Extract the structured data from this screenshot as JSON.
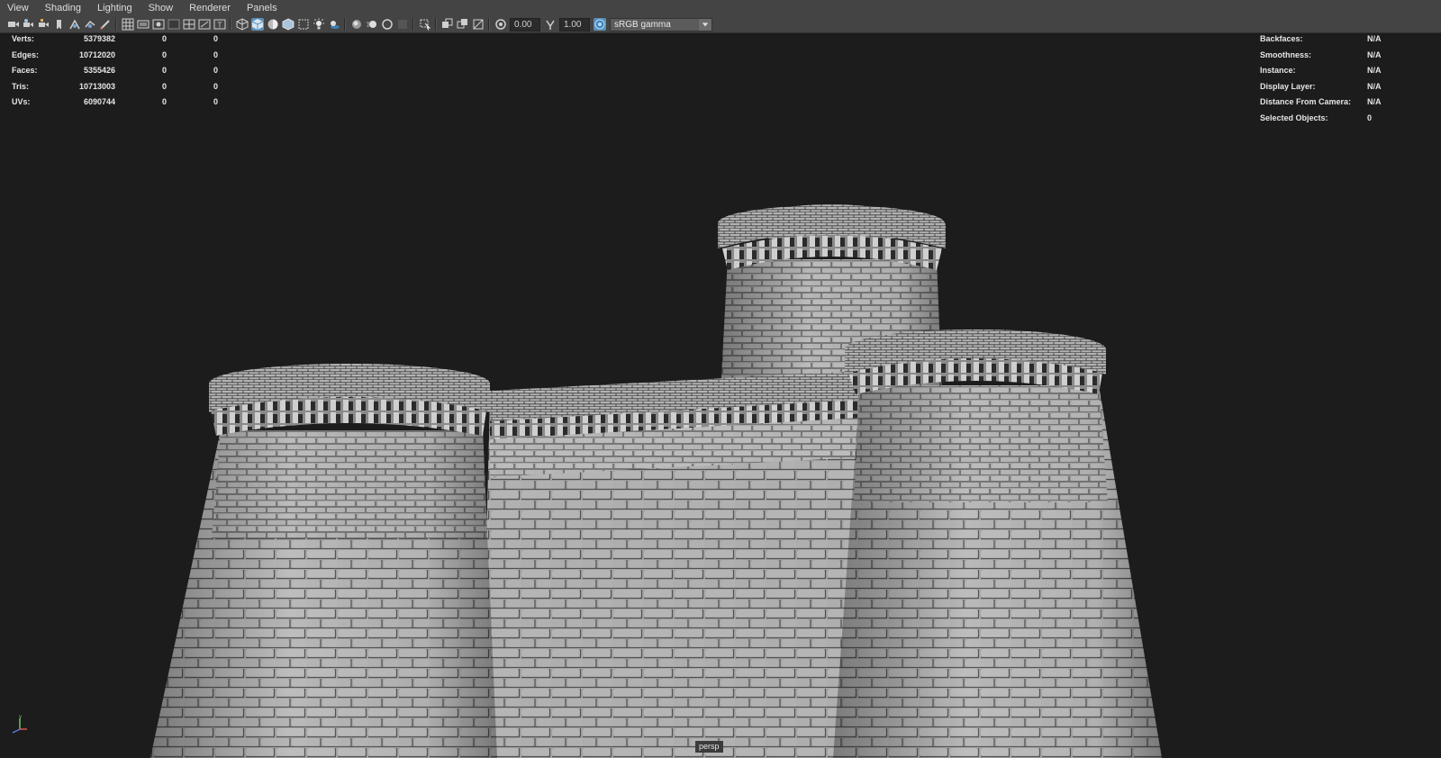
{
  "menu": [
    "View",
    "Shading",
    "Lighting",
    "Show",
    "Renderer",
    "Panels"
  ],
  "toolbar": {
    "exposure": "0.00",
    "gamma": "1.00",
    "color_space": "sRGB gamma",
    "icons": [
      "camera-icon",
      "camera-attributes-icon",
      "bookmark-icon",
      "image-plane-icon",
      "2d-pan-zoom-icon",
      "grease-pencil-icon",
      "grid-icon",
      "film-gate-icon",
      "resolution-gate-icon",
      "gate-mask-icon",
      "field-chart-icon",
      "safe-action-icon",
      "safe-title-icon",
      "wireframe-icon",
      "smooth-shade-icon",
      "default-material-icon",
      "wireframe-on-shaded-icon",
      "xray-icon",
      "lights-icon",
      "shadows-icon",
      "ambient-occlusion-icon",
      "motion-blur-icon",
      "anti-aliasing-icon",
      "depth-of-field-icon",
      "isolate-select-icon",
      "xray-joints-icon",
      "xray-active-icon",
      "backface-culling-icon",
      "exposure-icon",
      "gamma-icon",
      "color-management-icon",
      "dropdown-arrow-icon"
    ]
  },
  "stats_left": {
    "rows": [
      {
        "label": "Verts:",
        "total": "5379382",
        "sel": "0",
        "comp": "0"
      },
      {
        "label": "Edges:",
        "total": "10712020",
        "sel": "0",
        "comp": "0"
      },
      {
        "label": "Faces:",
        "total": "5355426",
        "sel": "0",
        "comp": "0"
      },
      {
        "label": "Tris:",
        "total": "10713003",
        "sel": "0",
        "comp": "0"
      },
      {
        "label": "UVs:",
        "total": "6090744",
        "sel": "0",
        "comp": "0"
      }
    ]
  },
  "stats_right": {
    "rows": [
      {
        "label": "Backfaces:",
        "value": "N/A"
      },
      {
        "label": "Smoothness:",
        "value": "N/A"
      },
      {
        "label": "Instance:",
        "value": "N/A"
      },
      {
        "label": "Display Layer:",
        "value": "N/A"
      },
      {
        "label": "Distance From Camera:",
        "value": "N/A"
      },
      {
        "label": "Selected Objects:",
        "value": "0"
      }
    ]
  },
  "camera_label": "persp",
  "axis": {
    "y": "y",
    "x": "x",
    "z": "z"
  }
}
